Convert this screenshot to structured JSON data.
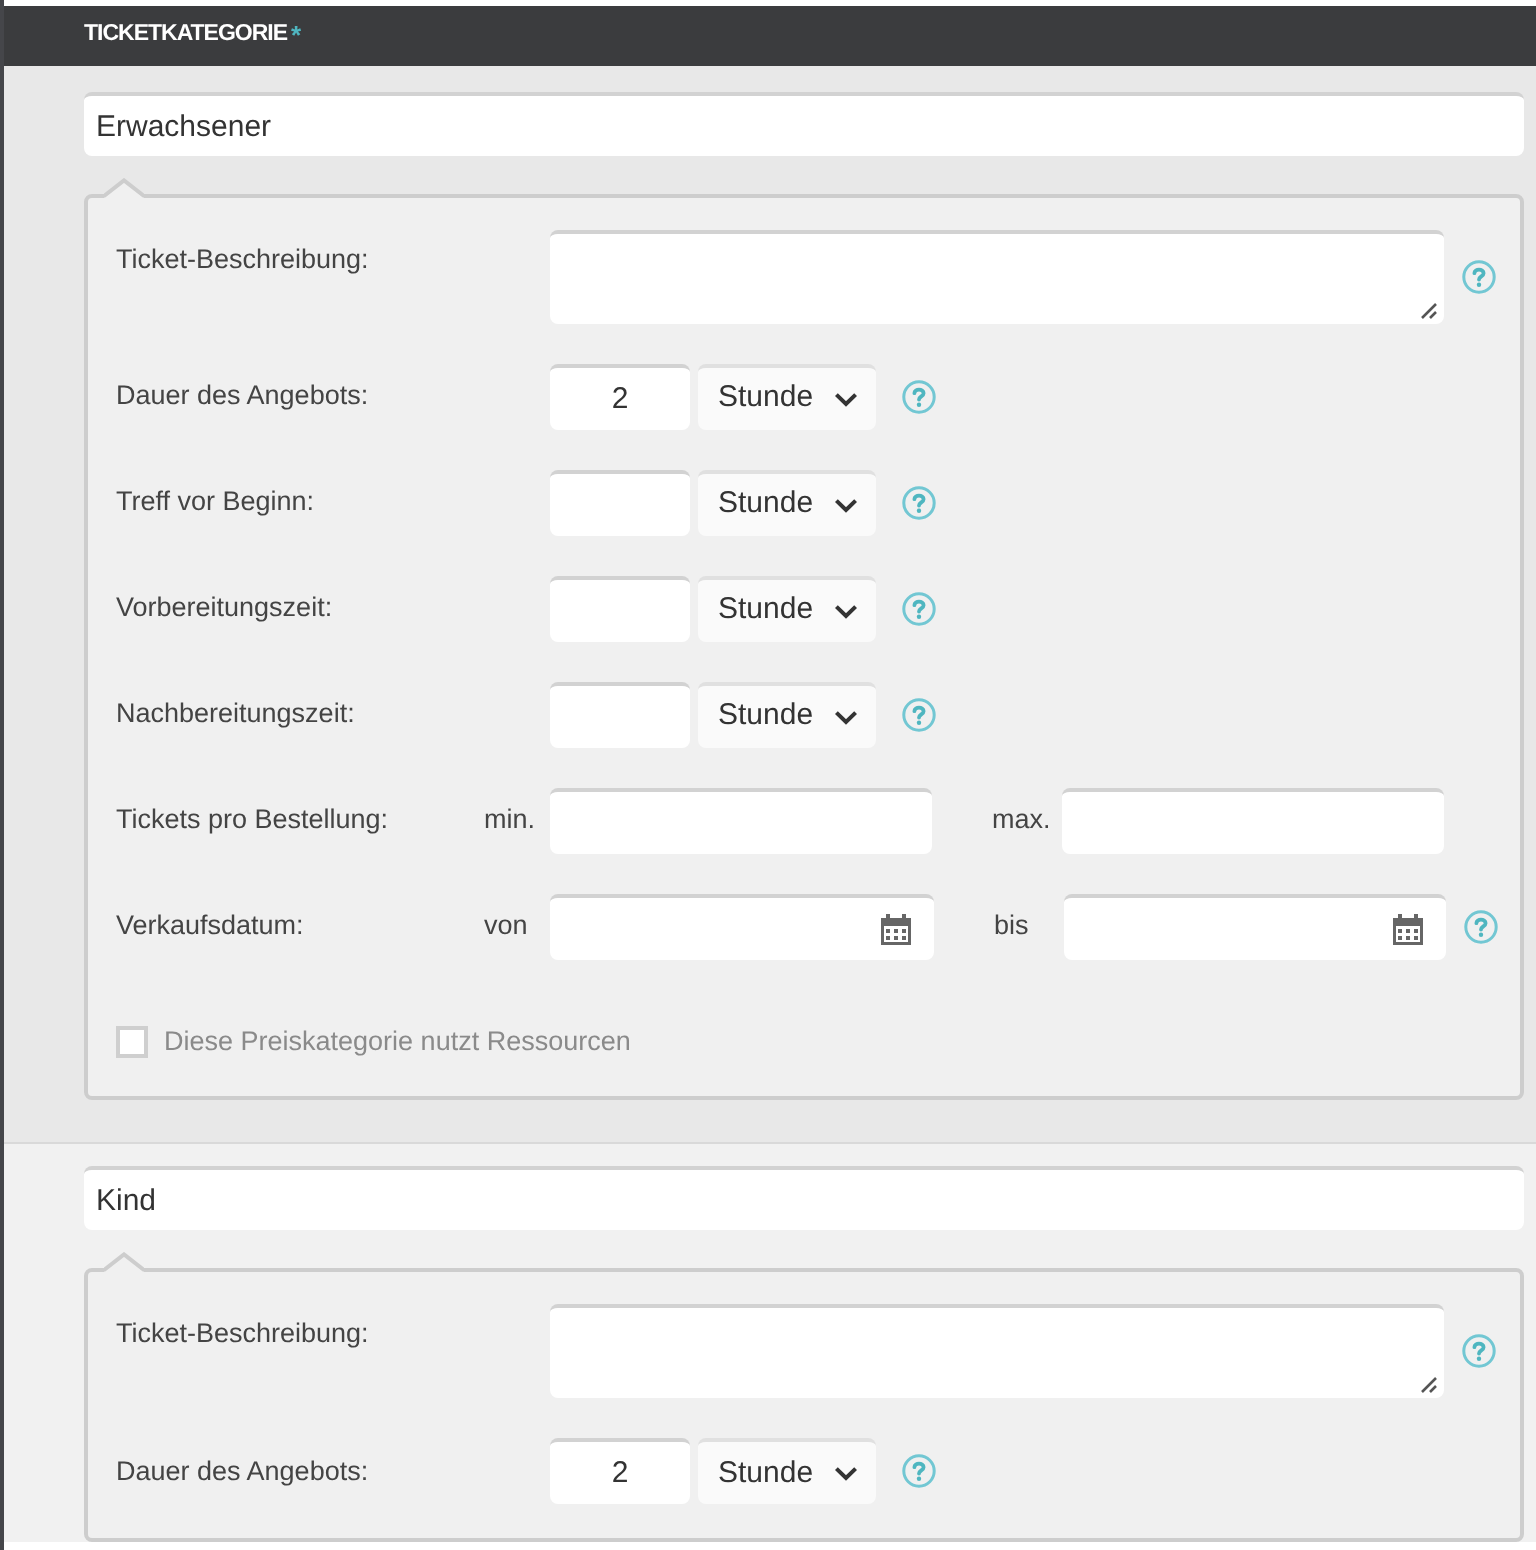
{
  "header": {
    "title": "TICKETKATEGORIE",
    "required_mark": "*"
  },
  "categories": [
    {
      "name": "Erwachsener",
      "fields": [
        {
          "kind": "textarea",
          "label": "Ticket-Beschreibung:",
          "help": true
        },
        {
          "kind": "duration",
          "label": "Dauer des Angebots:",
          "value": "2",
          "unit": "Stunde",
          "help": true
        },
        {
          "kind": "duration",
          "label": "Treff vor Beginn:",
          "unit": "Stunde",
          "help": true
        },
        {
          "kind": "duration",
          "label": "Vorbereitungszeit:",
          "unit": "Stunde",
          "help": true
        },
        {
          "kind": "duration",
          "label": "Nachbereitungszeit:",
          "unit": "Stunde",
          "help": true
        },
        {
          "kind": "range",
          "label": "Tickets pro Bestellung:",
          "from_label": "min.",
          "to_label": "max.",
          "help": false
        },
        {
          "kind": "date_range",
          "label": "Verkaufsdatum:",
          "from_label": "von",
          "to_label": "bis",
          "help": true
        },
        {
          "kind": "checkbox",
          "label": "Diese Preiskategorie nutzt Ressourcen",
          "checked": false
        }
      ]
    },
    {
      "name": "Kind",
      "fields": [
        {
          "kind": "textarea",
          "label": "Ticket-Beschreibung:",
          "help": true
        },
        {
          "kind": "duration",
          "label": "Dauer des Angebots:",
          "value": "2",
          "unit": "Stunde",
          "help": true
        }
      ]
    }
  ]
}
